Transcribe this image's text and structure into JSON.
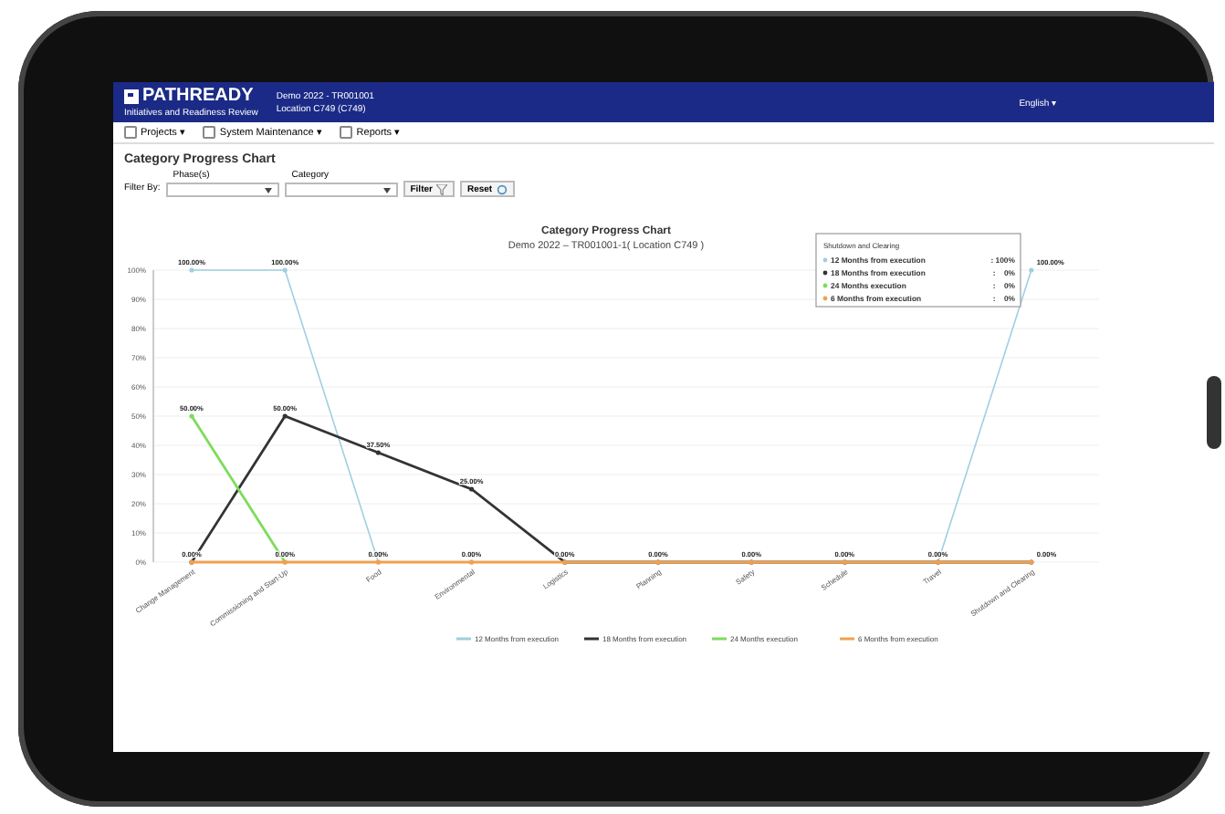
{
  "header": {
    "logo": "PATHREADY",
    "project": "Demo 2022 - TR001001",
    "location": "Location C749 (C749)",
    "subtitle": "Initiatives and Readiness Review",
    "language": "English ▾"
  },
  "menu": [
    {
      "label": "Projects ▾"
    },
    {
      "label": "System Maintenance ▾"
    },
    {
      "label": "Reports ▾"
    }
  ],
  "page_title": "Category Progress Chart",
  "filters": {
    "label": "Filter By:",
    "fields": [
      {
        "label": "Phase(s)"
      },
      {
        "label": "Category"
      }
    ],
    "filter_button": "Filter",
    "reset_button": "Reset"
  },
  "chart": {
    "chart_data": {
      "type": "line",
      "title": "Category Progress Chart",
      "subtitle": "Demo 2022 – TR001001-1( Location C749 )",
      "categories": [
        "Change Management",
        "Commissioning and Start-Up",
        "Food",
        "Environmental",
        "Logistics",
        "Planning",
        "Safety",
        "Schedule",
        "Travel",
        "Shutdown and Clearing"
      ],
      "ylim": [
        0,
        100
      ],
      "grid": true,
      "legend": true,
      "yticks": [
        {
          "value": 0,
          "label": "0%"
        },
        {
          "value": 10,
          "label": "10%"
        },
        {
          "value": 20,
          "label": "20%"
        },
        {
          "value": 30,
          "label": "30%"
        },
        {
          "value": 40,
          "label": "40%"
        },
        {
          "value": 50,
          "label": "50%"
        },
        {
          "value": 60,
          "label": "60%"
        },
        {
          "value": 70,
          "label": "70%"
        },
        {
          "value": 80,
          "label": "80%"
        },
        {
          "value": 90,
          "label": "90%"
        },
        {
          "value": 100,
          "label": "100%"
        }
      ],
      "series": [
        {
          "name": "12 Months from execution",
          "color": "#9fcfe0",
          "values": [
            100,
            100,
            0,
            0,
            0,
            0,
            0,
            0,
            0,
            100
          ]
        },
        {
          "name": "18 Months from execution",
          "color": "#333333",
          "values": [
            0,
            50,
            37.5,
            25,
            0,
            0,
            0,
            0,
            0,
            0
          ]
        },
        {
          "name": "24 Months execution",
          "color": "#7ddc5a",
          "values": [
            50,
            0,
            null,
            null,
            null,
            null,
            null,
            null,
            null,
            null
          ]
        },
        {
          "name": "6 Months from execution",
          "color": "#f0a050",
          "values": [
            0,
            0,
            0,
            0,
            0,
            0,
            0,
            0,
            0,
            0
          ]
        }
      ],
      "value_labels": [
        [
          "100.00%",
          "100.00%",
          null,
          null,
          null,
          null,
          null,
          null,
          null,
          "100.00%"
        ],
        [
          null,
          "50.00%",
          "37.50%",
          "25.00%",
          null,
          null,
          null,
          null,
          null,
          null
        ],
        [
          "50.00%",
          null,
          null,
          null,
          null,
          null,
          null,
          null,
          null,
          null
        ],
        [
          "0.00%",
          "0.00%",
          "0.00%",
          "0.00%",
          "0.00%",
          "0.00%",
          "0.00%",
          "0.00%",
          "0.00%",
          "0.00%"
        ]
      ]
    },
    "tooltip": {
      "title": "Shutdown and Clearing",
      "rows": [
        {
          "label": "12 Months from execution",
          "value": ": 100%"
        },
        {
          "label": "18 Months from execution",
          "value": ":    0%"
        },
        {
          "label": "24 Months execution",
          "value": ":    0%"
        },
        {
          "label": "6 Months from execution",
          "value": ":    0%"
        }
      ]
    }
  }
}
